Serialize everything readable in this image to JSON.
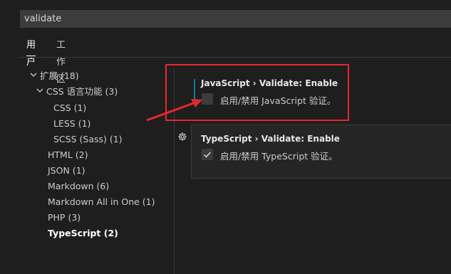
{
  "search": {
    "value": "validate"
  },
  "tabs": [
    {
      "label": "用户",
      "active": true
    },
    {
      "label": "工作区",
      "active": false
    }
  ],
  "toc": {
    "items": [
      {
        "label": "扩展 (18)",
        "expanded": true
      },
      {
        "label": "CSS 语言功能 (3)",
        "expanded": true
      },
      {
        "label": "CSS (1)"
      },
      {
        "label": "LESS (1)"
      },
      {
        "label": "SCSS (Sass) (1)"
      },
      {
        "label": "HTML (2)"
      },
      {
        "label": "JSON (1)"
      },
      {
        "label": "Markdown (6)"
      },
      {
        "label": "Markdown All in One (1)"
      },
      {
        "label": "PHP (3)"
      },
      {
        "label": "TypeScript (2)",
        "selected": true
      }
    ]
  },
  "settings": [
    {
      "category": "JavaScript › Validate: ",
      "name": "Enable",
      "description": "启用/禁用 JavaScript 验证。",
      "checked": false
    },
    {
      "category": "TypeScript › Validate: ",
      "name": "Enable",
      "description": "启用/禁用 TypeScript 验证。",
      "checked": true
    }
  ],
  "icons": {
    "gear": "gear-icon",
    "check": "checkmark-icon",
    "chevron": "chevron-down-icon"
  },
  "colors": {
    "highlight": "#e5282e",
    "modified_indicator": "#0c7d9d"
  }
}
